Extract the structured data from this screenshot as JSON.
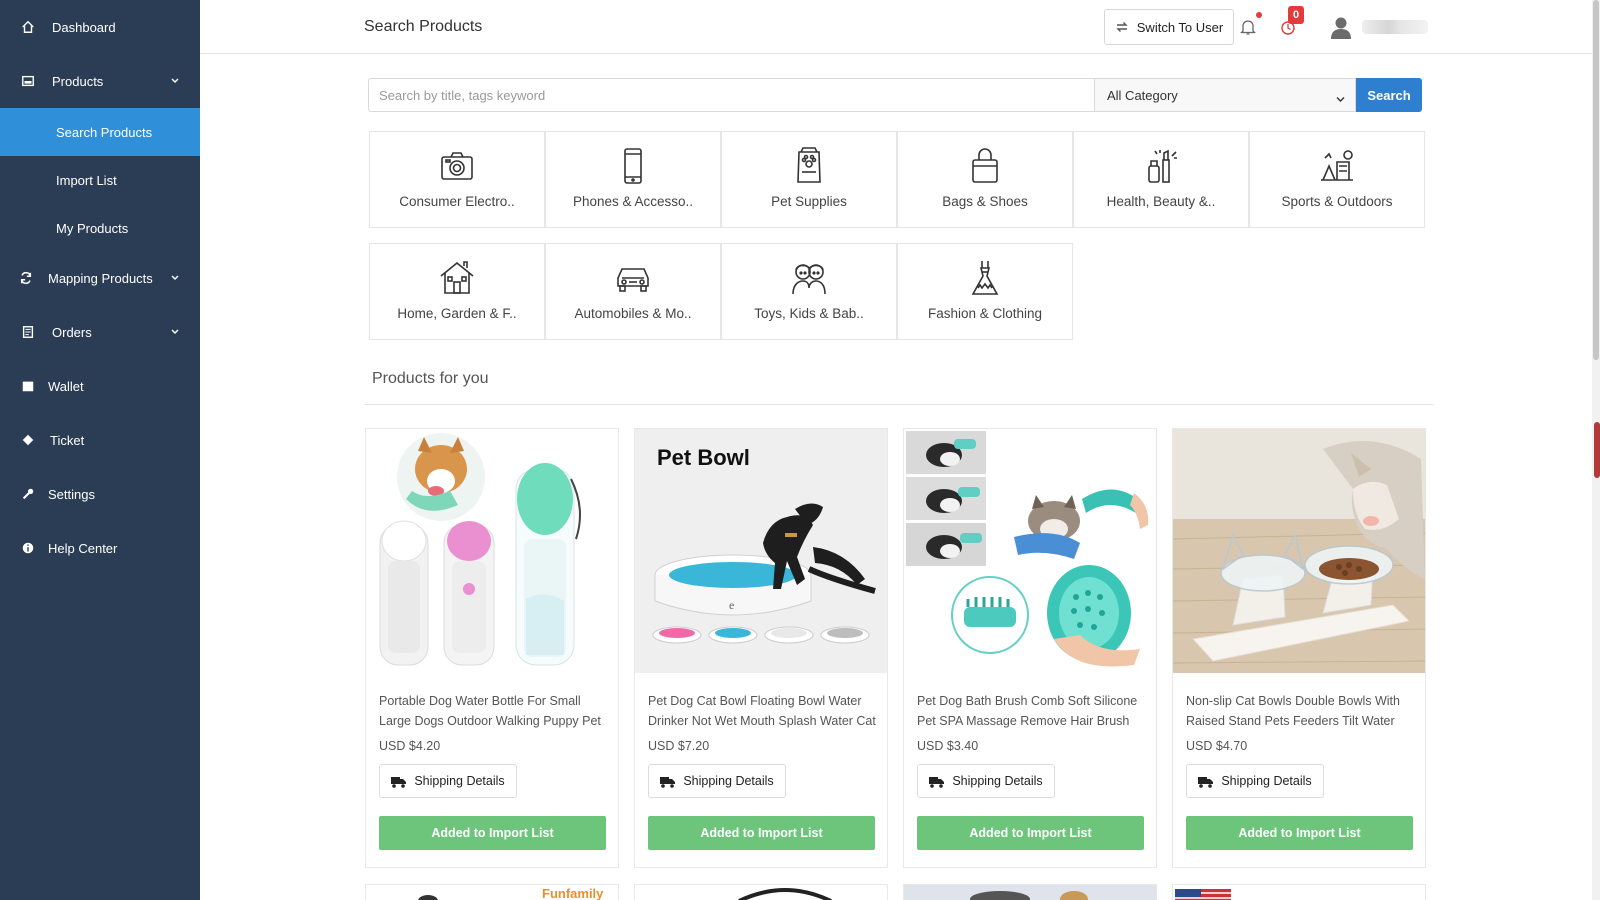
{
  "sidebar": {
    "items": [
      {
        "label": "Dashboard",
        "icon": "home-icon"
      },
      {
        "label": "Products",
        "icon": "image-icon"
      },
      {
        "label": "Mapping Products",
        "icon": "refresh-icon"
      },
      {
        "label": "Orders",
        "icon": "receipt-icon"
      },
      {
        "label": "Wallet",
        "icon": "wallet-icon"
      },
      {
        "label": "Ticket",
        "icon": "ticket-icon"
      },
      {
        "label": "Settings",
        "icon": "wrench-icon"
      },
      {
        "label": "Help Center",
        "icon": "info-icon"
      }
    ],
    "products_sub": [
      {
        "label": "Search Products",
        "active": true
      },
      {
        "label": "Import List",
        "active": false
      },
      {
        "label": "My Products",
        "active": false
      }
    ],
    "colors": {
      "bg": "#2b3d55",
      "active": "#2f8fd8"
    }
  },
  "header": {
    "title": "Search Products",
    "switch_label": "Switch To User",
    "timer_badge": "0"
  },
  "search": {
    "placeholder": "Search by title, tags keyword",
    "category_value": "All Category",
    "button_label": "Search"
  },
  "categories": [
    {
      "label": "Consumer Electro..",
      "icon": "camera-icon"
    },
    {
      "label": "Phones & Accesso..",
      "icon": "phone-icon"
    },
    {
      "label": "Pet Supplies",
      "icon": "pet-food-icon"
    },
    {
      "label": "Bags & Shoes",
      "icon": "bag-icon"
    },
    {
      "label": "Health, Beauty &..",
      "icon": "cosmetics-icon"
    },
    {
      "label": "Sports & Outdoors",
      "icon": "sports-icon"
    },
    {
      "label": "Home, Garden & F..",
      "icon": "house-icon"
    },
    {
      "label": "Automobiles & Mo..",
      "icon": "car-icon"
    },
    {
      "label": "Toys, Kids & Bab..",
      "icon": "kids-icon"
    },
    {
      "label": "Fashion & Clothing",
      "icon": "dress-icon"
    }
  ],
  "products_section": {
    "title": "Products for you",
    "products": [
      {
        "title": "Portable Dog Water Bottle For Small Large Dogs Outdoor Walking Puppy Pet",
        "price": "USD $4.20",
        "shipping_label": "Shipping Details",
        "action_label": "Added to Import List"
      },
      {
        "title": "Pet Dog Cat Bowl Floating Bowl Water Drinker Not Wet Mouth Splash Water Cat",
        "price": "USD $7.20",
        "shipping_label": "Shipping Details",
        "action_label": "Added to Import List",
        "image_text": "Pet Bowl"
      },
      {
        "title": "Pet Dog Bath Brush Comb Soft Silicone Pet SPA Massage Remove Hair Brush",
        "price": "USD $3.40",
        "shipping_label": "Shipping Details",
        "action_label": "Added to Import List"
      },
      {
        "title": "Non-slip Cat Bowls Double Bowls With Raised Stand Pets Feeders Tilt Water",
        "price": "USD $4.70",
        "shipping_label": "Shipping Details",
        "action_label": "Added to Import List"
      }
    ],
    "next_row_peek_text": "Funfamily"
  },
  "colors": {
    "primary": "#2f7fd1",
    "success": "#6cc57a",
    "badge": "#e23b3b"
  }
}
